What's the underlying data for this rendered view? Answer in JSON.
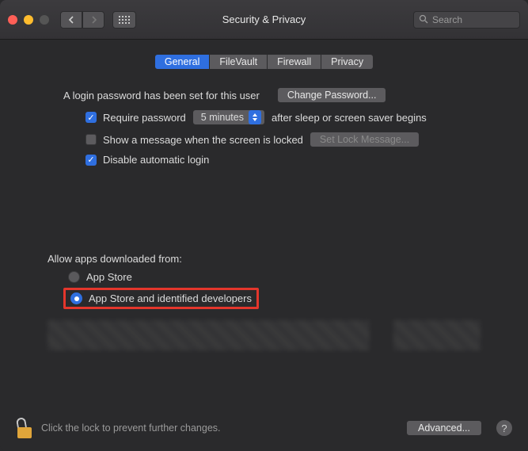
{
  "window": {
    "title": "Security & Privacy"
  },
  "search": {
    "placeholder": "Search"
  },
  "tabs": [
    {
      "label": "General",
      "active": true
    },
    {
      "label": "FileVault",
      "active": false
    },
    {
      "label": "Firewall",
      "active": false
    },
    {
      "label": "Privacy",
      "active": false
    }
  ],
  "login": {
    "password_set_text": "A login password has been set for this user",
    "change_password_btn": "Change Password...",
    "require_pw_label": "Require password",
    "require_pw_delay": "5 minutes",
    "require_pw_after": "after sleep or screen saver begins",
    "show_message_label": "Show a message when the screen is locked",
    "set_lock_message_btn": "Set Lock Message...",
    "disable_auto_login_label": "Disable automatic login"
  },
  "allow": {
    "heading": "Allow apps downloaded from:",
    "app_store": "App Store",
    "identified": "App Store and identified developers"
  },
  "footer": {
    "lock_text": "Click the lock to prevent further changes.",
    "advanced_btn": "Advanced..."
  }
}
